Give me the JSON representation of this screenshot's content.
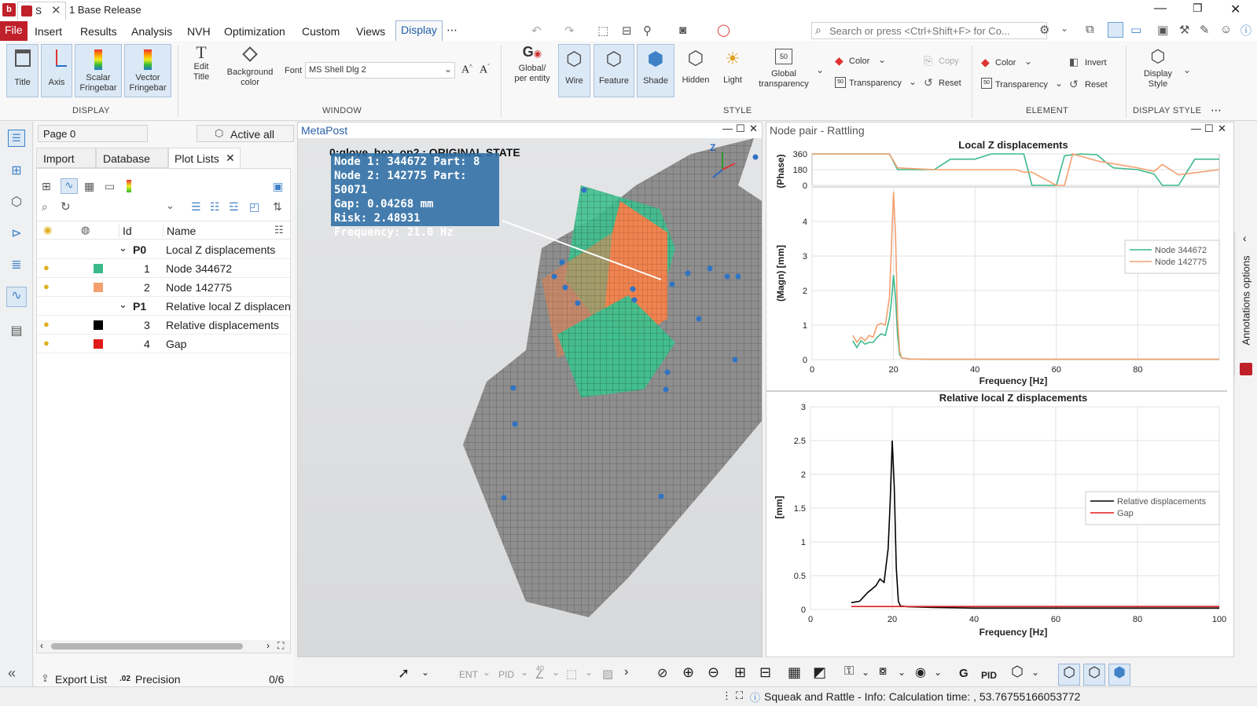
{
  "app": {
    "title": "1 Base Release",
    "tab_short": "S"
  },
  "menu": [
    "File",
    "Insert",
    "Results",
    "Analysis",
    "NVH",
    "Optimization",
    "Custom",
    "Views",
    "Display"
  ],
  "search": {
    "placeholder": "Search or press <Ctrl+Shift+F> for Co..."
  },
  "ribbon": {
    "display": {
      "group": "DISPLAY",
      "title": "Title",
      "axis": "Axis",
      "scalar": "Scalar Fringebar",
      "vector": "Vector Fringebar"
    },
    "window": {
      "group": "WINDOW",
      "edit_title": "Edit Title",
      "bg_color": "Background color",
      "font_label": "Font",
      "font_value": "MS Shell Dlg 2"
    },
    "style": {
      "group": "STYLE",
      "global_per_entity": "Global/ per entity",
      "wire": "Wire",
      "feature": "Feature",
      "shade": "Shade",
      "hidden": "Hidden",
      "light": "Light",
      "global_transparency": "Global transparency",
      "transparency_value": "50",
      "color": "Color",
      "transparency": "Transparency",
      "copy": "Copy",
      "reset": "Reset"
    },
    "element": {
      "group": "ELEMENT",
      "color": "Color",
      "transparency": "Transparency",
      "invert": "Invert",
      "reset": "Reset"
    },
    "display_style": {
      "group": "DISPLAY STYLE",
      "label": "Display Style"
    }
  },
  "left": {
    "page": "Page 0",
    "active_all": "Active all",
    "tabs": [
      "Import",
      "Database",
      "Plot Lists"
    ],
    "columns": {
      "id": "Id",
      "name": "Name"
    },
    "rows": [
      {
        "level": 0,
        "id": "P0",
        "name": "Local Z displacements"
      },
      {
        "level": 1,
        "id": "1",
        "name": "Node 344672",
        "color": "#3cb98a"
      },
      {
        "level": 1,
        "id": "2",
        "name": "Node 142775",
        "color": "#f4a070"
      },
      {
        "level": 0,
        "id": "P1",
        "name": "Relative local Z displacen"
      },
      {
        "level": 1,
        "id": "3",
        "name": "Relative displacements",
        "color": "#000000"
      },
      {
        "level": 1,
        "id": "4",
        "name": "Gap",
        "color": "#e01b1b"
      }
    ],
    "export": "Export List",
    "precision_icon": ".02",
    "precision": "Precision",
    "count": "0/6"
  },
  "viewport": {
    "title": "MetaPost",
    "model_label": "0:glove_box_op2 : ORIGINAL STATE",
    "info": [
      "Node 1: 344672 Part: 8",
      "Node 2: 142775 Part: 50071",
      "Gap: 0.04268 mm",
      "Risk: 2.48931",
      "Frequency: 21.0 Hz"
    ],
    "axis_z": "Z"
  },
  "plots": {
    "window_title": "Node pair - Rattling",
    "annotations": "Annotations options",
    "top": {
      "title": "Local Z displacements",
      "ylabel_phase": "(Phase)",
      "ylabel_magn": "(Magn) [mm]",
      "xlabel": "Frequency [Hz]",
      "legend": [
        "Node 344672",
        "Node 142775"
      ]
    },
    "bottom": {
      "title": "Relative local Z displacements",
      "ylabel": "[mm]",
      "xlabel": "Frequency [Hz]",
      "legend": [
        "Relative displacements",
        "Gap"
      ]
    }
  },
  "toolbar": {
    "ent": "ENT",
    "pid": "PID",
    "angle": "40",
    "g": "G",
    "pid2": "PID"
  },
  "status": {
    "text": "Squeak and Rattle - Info: Calculation time: , 53.76755166053772"
  },
  "chart_data": [
    {
      "type": "line",
      "title": "Local Z displacements (Phase)",
      "ylabel": "(Phase)",
      "xlim": [
        0,
        100
      ],
      "ylim": [
        0,
        360
      ],
      "yticks": [
        0,
        180,
        360
      ],
      "series": [
        {
          "name": "Node 344672",
          "color": "#3cb98a",
          "x": [
            0,
            19,
            21,
            30,
            34,
            40,
            44,
            52,
            54,
            60,
            62,
            66,
            70,
            72,
            74,
            80,
            84,
            86,
            90,
            94,
            100
          ],
          "y": [
            360,
            360,
            180,
            180,
            300,
            300,
            360,
            360,
            0,
            0,
            340,
            360,
            350,
            270,
            200,
            180,
            130,
            0,
            0,
            300,
            300
          ]
        },
        {
          "name": "Node 142775",
          "color": "#f4a070",
          "x": [
            0,
            19,
            21,
            30,
            40,
            50,
            52,
            54,
            60,
            62,
            64,
            70,
            80,
            84,
            86,
            90,
            100
          ],
          "y": [
            360,
            360,
            200,
            180,
            180,
            180,
            150,
            150,
            0,
            0,
            360,
            280,
            200,
            160,
            240,
            120,
            180
          ]
        }
      ]
    },
    {
      "type": "line",
      "title": "Local Z displacements",
      "xlabel": "Frequency [Hz]",
      "ylabel": "(Magn) [mm]",
      "xlim": [
        0,
        100
      ],
      "ylim": [
        0,
        5
      ],
      "xticks": [
        0,
        20,
        40,
        60,
        80
      ],
      "yticks": [
        0,
        1,
        2,
        3,
        4
      ],
      "series": [
        {
          "name": "Node 344672",
          "color": "#3cb98a",
          "x": [
            10,
            11,
            12,
            13,
            14,
            15,
            16,
            17,
            18,
            19,
            19.5,
            20,
            20.5,
            21,
            21.5,
            22,
            24,
            30,
            50,
            100
          ],
          "y": [
            0.55,
            0.35,
            0.55,
            0.45,
            0.5,
            0.5,
            0.65,
            0.75,
            0.7,
            1.2,
            1.7,
            2.45,
            1.8,
            0.7,
            0.15,
            0.05,
            0.02,
            0.01,
            0.01,
            0.01
          ]
        },
        {
          "name": "Node 142775",
          "color": "#f4a070",
          "x": [
            10,
            11,
            12,
            13,
            14,
            15,
            16,
            17,
            18,
            19,
            19.5,
            20,
            20.5,
            21,
            21.5,
            22,
            24,
            30,
            50,
            100
          ],
          "y": [
            0.7,
            0.5,
            0.65,
            0.55,
            0.7,
            0.65,
            1.0,
            1.05,
            1.0,
            1.8,
            3.3,
            4.85,
            3.6,
            1.2,
            0.25,
            0.05,
            0.02,
            0.01,
            0.01,
            0.01
          ]
        }
      ]
    },
    {
      "type": "line",
      "title": "Relative local Z displacements",
      "xlabel": "Frequency [Hz]",
      "ylabel": "[mm]",
      "xlim": [
        0,
        100
      ],
      "ylim": [
        0,
        3
      ],
      "xticks": [
        0,
        20,
        40,
        60,
        80,
        100
      ],
      "yticks": [
        0,
        0.5,
        1,
        1.5,
        2,
        2.5,
        3
      ],
      "series": [
        {
          "name": "Relative displacements",
          "color": "#000000",
          "x": [
            10,
            12,
            14,
            15,
            16,
            17,
            18,
            19,
            19.5,
            20,
            20.5,
            21,
            21.5,
            22,
            24,
            30,
            40,
            100
          ],
          "y": [
            0.1,
            0.12,
            0.25,
            0.3,
            0.35,
            0.45,
            0.4,
            0.9,
            1.6,
            2.5,
            1.8,
            0.6,
            0.12,
            0.05,
            0.04,
            0.03,
            0.02,
            0.02
          ]
        },
        {
          "name": "Gap",
          "color": "#e01b1b",
          "x": [
            10,
            100
          ],
          "y": [
            0.04268,
            0.04268
          ]
        }
      ]
    }
  ]
}
